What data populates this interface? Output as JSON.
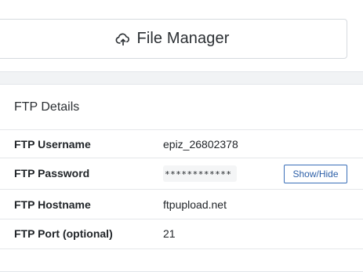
{
  "file_manager": {
    "label": "File Manager",
    "icon": "cloud-upload-icon"
  },
  "ftp_details": {
    "title": "FTP Details",
    "rows": [
      {
        "label": "FTP Username",
        "value": "epiz_26802378"
      },
      {
        "label": "FTP Password",
        "value": "************",
        "button": "Show/Hide"
      },
      {
        "label": "FTP Hostname",
        "value": "ftpupload.net"
      },
      {
        "label": "FTP Port (optional)",
        "value": "21"
      }
    ]
  },
  "colors": {
    "page_bg": "#f1f3f5",
    "card_bg": "#ffffff",
    "accent": "#2c5fa8"
  }
}
